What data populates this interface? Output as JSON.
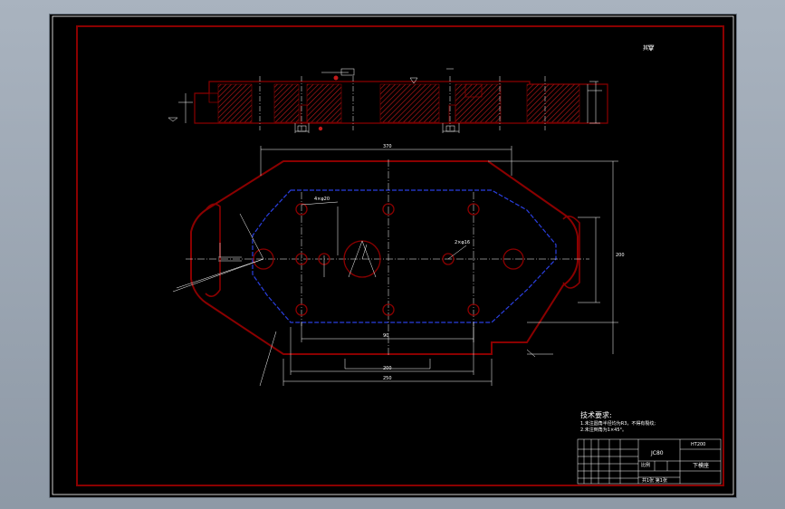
{
  "drawing": {
    "drawing_number": "JC80",
    "part_name": "下模座",
    "roughness_note": "其余",
    "tech_req": {
      "title": "技术要求:",
      "items": [
        "1.未注圆角半径均为R3，不得有裂纹;",
        "2.未注倒角为1×45°。"
      ]
    },
    "title_block": {
      "scale_label": "比例",
      "sheet_label": "共1张 第1张",
      "material": "HT200"
    },
    "dimensions": {
      "overall_length": "370",
      "overall_width": "200",
      "bottom_length": "250",
      "inner_length": "200",
      "slot_length": "90",
      "hole_label_left": "4×φ20",
      "hole_label_right": "2×φ16"
    }
  },
  "colors": {
    "background": "#000000",
    "frame": "#8b0000",
    "outline": "#8b0000",
    "hatch": "#c21a1a",
    "hidden": "#2a3fe0",
    "dimension": "#ffffff"
  }
}
